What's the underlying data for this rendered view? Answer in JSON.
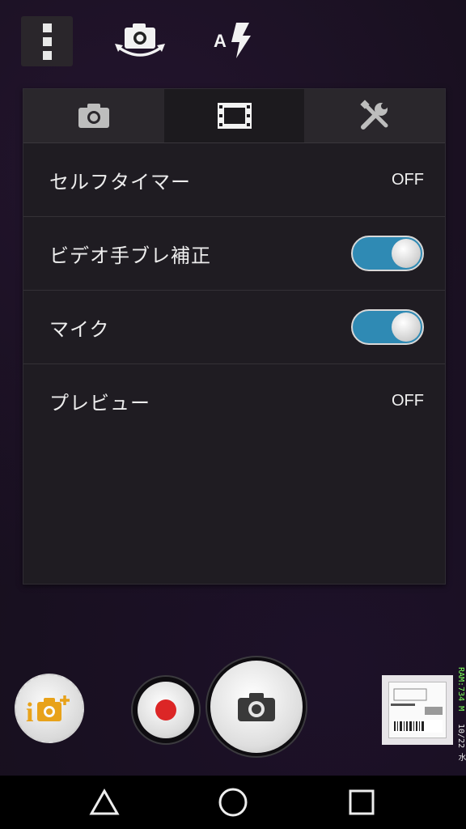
{
  "toolbar": {
    "menu_icon": "overflow-menu-icon",
    "switch_camera_icon": "switch-camera-icon",
    "flash_icon": "flash-auto-icon",
    "flash_label": "A"
  },
  "panel": {
    "tabs": [
      {
        "icon": "camera-icon",
        "active": false
      },
      {
        "icon": "film-icon",
        "active": true
      },
      {
        "icon": "tools-icon",
        "active": false
      }
    ],
    "rows": [
      {
        "label": "セルフタイマー",
        "value": "OFF"
      },
      {
        "label": "ビデオ手ブレ補正",
        "toggle": true
      },
      {
        "label": "マイク",
        "toggle": true
      },
      {
        "label": "プレビュー",
        "value": "OFF"
      }
    ]
  },
  "bottom": {
    "ia_button_icon": "superior-auto-camera-icon",
    "ia_label": "i",
    "record_icon": "record-icon",
    "shutter_icon": "camera-shutter-icon",
    "thumbnail": "last-photo-thumbnail"
  },
  "status_overlay": {
    "ram": "RAM:734 M",
    "date": "10/22 水"
  },
  "navbar": {
    "back_icon": "back-triangle-icon",
    "home_icon": "home-circle-icon",
    "recents_icon": "recents-square-icon"
  },
  "colors": {
    "toggle_on": "#2f8ab4",
    "record": "#dc2626",
    "ram_text": "#7cff5a"
  }
}
